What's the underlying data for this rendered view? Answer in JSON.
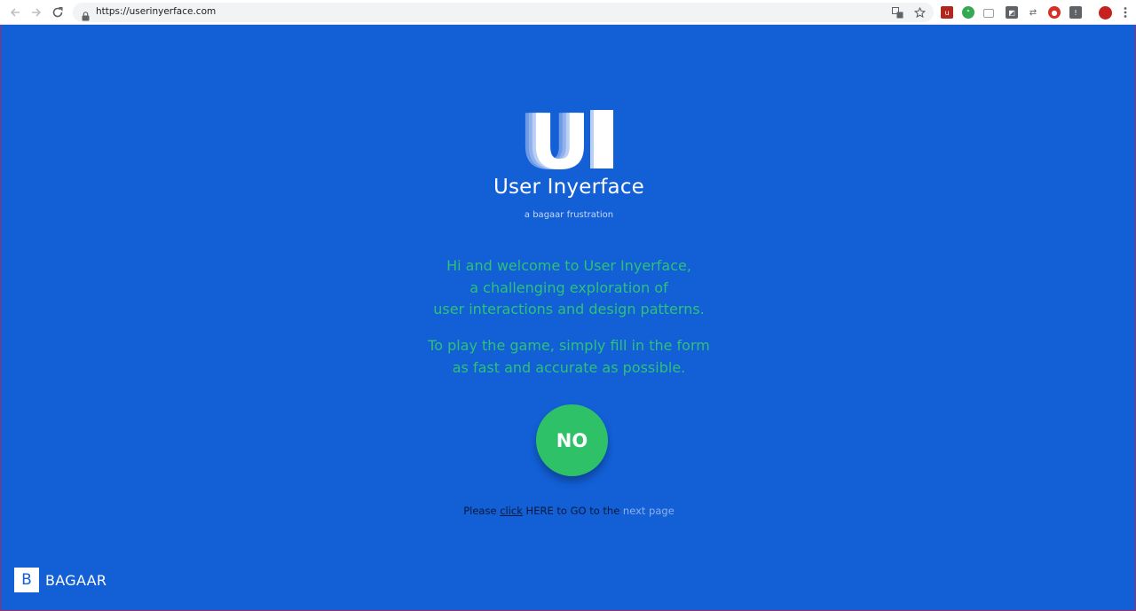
{
  "browser": {
    "url": "https://userinyerface.com"
  },
  "page": {
    "logo_letters": "UI",
    "title": "User Inyerface",
    "subtitle": "a bagaar frustration",
    "intro_lines": [
      "Hi and welcome to User Inyerface,",
      "a challenging exploration of",
      "user interactions and design patterns."
    ],
    "instruction_lines": [
      "To play the game, simply fill in the form",
      "as fast and accurate as possible."
    ],
    "no_button_label": "NO",
    "nav_text": {
      "please": "Please ",
      "click": "click",
      "here_go_to_the": " HERE to GO to the ",
      "next_page": "next page"
    },
    "footer_logo": {
      "letter": "B",
      "word": "BAGAAR"
    }
  },
  "colors": {
    "background": "#125fd6",
    "accent_green": "#2ec167",
    "text_green": "#2ec177",
    "white": "#ffffff"
  },
  "icons": [
    "back-arrow-icon",
    "forward-arrow-icon",
    "reload-icon",
    "lock-icon",
    "translate-icon",
    "bookmark-star-icon",
    "menu-dots-icon"
  ]
}
